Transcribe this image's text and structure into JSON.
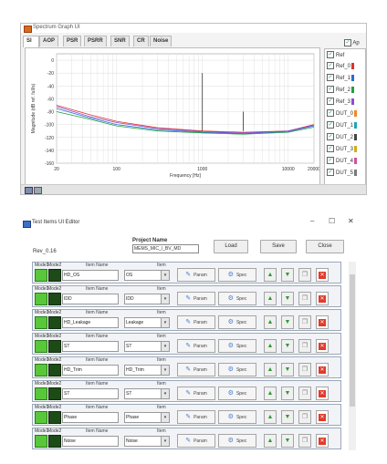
{
  "spectrum_window": {
    "title": "Spectrum Graph UI",
    "tabs": [
      "SI",
      "AOP",
      "PSR",
      "PSRR",
      "SNR",
      "CR",
      "Noise"
    ],
    "active_tab": "SI",
    "apply_label": "Ap",
    "legend_header": "Ref",
    "legend_items": [
      "Ref_0",
      "Ref_1",
      "Ref_2",
      "Ref_3",
      "DUT_0",
      "DUT_1",
      "DUT_2",
      "DUT_3",
      "DUT_4",
      "DUT_5"
    ]
  },
  "chart_data": {
    "type": "line",
    "ylabel": "Magnitude (dB ref. full/s)",
    "xlabel": "Frequency [Hz]",
    "x_scale": "log",
    "xlim": [
      20,
      20000
    ],
    "ylim": [
      -160,
      10
    ],
    "x_ticks": [
      "20",
      "100",
      "1000",
      "10000",
      "20000"
    ],
    "y_ticks": [
      "0",
      "-20",
      "-40",
      "-60",
      "-80",
      "-100",
      "-120",
      "-140",
      "-160"
    ],
    "grid": true,
    "series_colors": [
      "#e0302a",
      "#2a6ad6",
      "#20a040",
      "#8a4fd0",
      "#f08a20",
      "#1aa8b8",
      "#444444",
      "#c8b020",
      "#d050a0",
      "#7a7a7a"
    ],
    "series": [
      {
        "x": [
          20,
          50,
          100,
          300,
          1000,
          3000,
          10000,
          20000
        ],
        "values": [
          -70,
          -85,
          -95,
          -105,
          -110,
          -112,
          -110,
          -100
        ]
      },
      {
        "x": [
          20,
          50,
          100,
          300,
          1000,
          3000,
          10000,
          20000
        ],
        "values": [
          -75,
          -90,
          -100,
          -108,
          -112,
          -114,
          -111,
          -102
        ]
      },
      {
        "x": [
          20,
          50,
          100,
          300,
          1000,
          3000,
          10000,
          20000
        ],
        "values": [
          -80,
          -92,
          -102,
          -110,
          -113,
          -115,
          -112,
          -104
        ]
      },
      {
        "x": [
          20,
          50,
          100,
          300,
          1000,
          3000,
          10000,
          20000
        ],
        "values": [
          -72,
          -88,
          -97,
          -106,
          -111,
          -113,
          -110,
          -101
        ]
      }
    ],
    "peaks": [
      {
        "x": 1000,
        "value": -20
      },
      {
        "x": 3000,
        "value": -80
      }
    ]
  },
  "test_window": {
    "title": "Test Items UI Editor",
    "project_name_label": "Project Name",
    "project_name_value": "MEMS_MIC_/_BV_MD",
    "revision": "Rev_0.16",
    "buttons": {
      "load": "Load",
      "save": "Save",
      "close": "Close"
    },
    "window_controls": {
      "minimize": "–",
      "maximize": "☐",
      "close": "✕"
    },
    "row_labels": {
      "mode1": "Mode1",
      "mode2": "Mode2",
      "item_name": "Item Name",
      "item": "Item",
      "param": "Param",
      "spec": "Spec"
    },
    "rows": [
      {
        "name": "HD_OS",
        "item": "OS"
      },
      {
        "name": "IDD",
        "item": "IDD"
      },
      {
        "name": "HD_Leakage",
        "item": "Leakage"
      },
      {
        "name": "ST",
        "item": "ST"
      },
      {
        "name": "HD_Trim",
        "item": "HD_Trim"
      },
      {
        "name": "ST",
        "item": "ST"
      },
      {
        "name": "Phase",
        "item": "Phase"
      },
      {
        "name": "Noise",
        "item": "Noise"
      }
    ]
  }
}
